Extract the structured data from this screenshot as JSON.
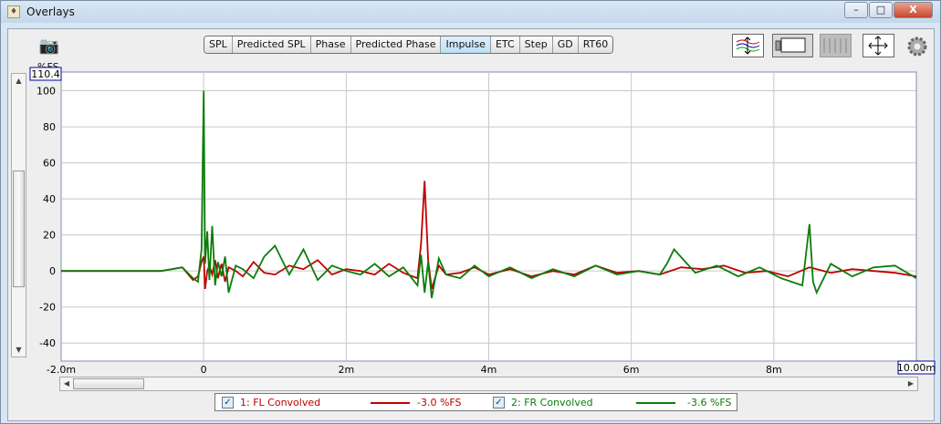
{
  "window": {
    "title": "Overlays",
    "controls": [
      "–",
      "□",
      "X"
    ]
  },
  "tabs": [
    "SPL",
    "Predicted SPL",
    "Phase",
    "Predicted Phase",
    "Impulse",
    "ETC",
    "Step",
    "GD",
    "RT60"
  ],
  "active_tab": "Impulse",
  "icons": {
    "camera": "camera-icon",
    "tools": [
      "trace-arrange-icon",
      "monitor-icon",
      "grid-panel-icon",
      "move-icon",
      "gear-icon"
    ]
  },
  "axis": {
    "y_unit": "%FS",
    "y_top_marker": "110.4",
    "x_right_marker": "10.00m"
  },
  "legend": [
    {
      "name": "1: FL Convolved",
      "value": "-3.0 %FS",
      "color": "#c00000"
    },
    {
      "name": "2: FR Convolved",
      "value": "-3.6 %FS",
      "color": "#0a7d0a"
    }
  ],
  "chart_data": {
    "type": "line",
    "x_ticks": [
      "-2.0m",
      "0",
      "2m",
      "4m",
      "6m",
      "8m"
    ],
    "y_ticks": [
      100,
      80,
      60,
      40,
      20,
      0,
      -20,
      -40
    ],
    "xlim": [
      -2.0,
      10.0
    ],
    "ylim": [
      -50,
      110.4
    ],
    "grid": true,
    "series": [
      {
        "name": "1: FL Convolved",
        "color": "#c00000",
        "x": [
          -2.0,
          -1.5,
          -1.0,
          -0.6,
          -0.3,
          -0.15,
          -0.08,
          -0.03,
          0.0,
          0.02,
          0.05,
          0.08,
          0.12,
          0.16,
          0.2,
          0.25,
          0.3,
          0.35,
          0.45,
          0.55,
          0.7,
          0.85,
          1.0,
          1.2,
          1.4,
          1.6,
          1.8,
          2.0,
          2.2,
          2.4,
          2.6,
          2.8,
          3.0,
          3.05,
          3.1,
          3.15,
          3.2,
          3.3,
          3.4,
          3.6,
          3.8,
          4.0,
          4.3,
          4.6,
          4.9,
          5.2,
          5.5,
          5.8,
          6.1,
          6.4,
          6.7,
          7.0,
          7.3,
          7.6,
          7.9,
          8.2,
          8.5,
          8.8,
          9.1,
          9.4,
          9.7,
          10.0
        ],
        "y": [
          0,
          0,
          0,
          0,
          2,
          -5,
          -3,
          5,
          8,
          -10,
          0,
          3,
          -2,
          6,
          -4,
          4,
          -6,
          2,
          0,
          -3,
          5,
          -1,
          -2,
          3,
          1,
          6,
          -2,
          1,
          0,
          -2,
          4,
          -1,
          -4,
          15,
          50,
          6,
          -10,
          3,
          -2,
          -1,
          2,
          -2,
          1,
          -3,
          0,
          -2,
          3,
          -1,
          0,
          -2,
          2,
          1,
          3,
          -1,
          0,
          -3,
          2,
          -1,
          1,
          0,
          -1,
          -3
        ]
      },
      {
        "name": "2: FR Convolved",
        "color": "#0a7d0a",
        "x": [
          -2.0,
          -1.5,
          -1.0,
          -0.6,
          -0.3,
          -0.15,
          -0.08,
          -0.03,
          0.0,
          0.02,
          0.05,
          0.08,
          0.12,
          0.16,
          0.2,
          0.25,
          0.3,
          0.35,
          0.45,
          0.55,
          0.7,
          0.85,
          1.0,
          1.2,
          1.4,
          1.6,
          1.8,
          2.0,
          2.2,
          2.4,
          2.6,
          2.8,
          3.0,
          3.05,
          3.1,
          3.15,
          3.2,
          3.3,
          3.4,
          3.6,
          3.8,
          4.0,
          4.3,
          4.6,
          4.9,
          5.2,
          5.5,
          5.8,
          6.1,
          6.4,
          6.5,
          6.6,
          6.9,
          7.2,
          7.5,
          7.8,
          8.1,
          8.4,
          8.5,
          8.55,
          8.6,
          8.8,
          9.1,
          9.4,
          9.7,
          10.0
        ],
        "y": [
          0,
          0,
          0,
          0,
          2,
          -4,
          -6,
          12,
          100,
          4,
          22,
          -5,
          25,
          -8,
          5,
          -3,
          8,
          -12,
          3,
          1,
          -4,
          8,
          14,
          -2,
          12,
          -5,
          3,
          0,
          -2,
          4,
          -3,
          2,
          -8,
          9,
          -12,
          5,
          -15,
          7,
          -2,
          -4,
          3,
          -3,
          2,
          -4,
          1,
          -3,
          3,
          -2,
          0,
          -2,
          4,
          12,
          -1,
          3,
          -3,
          2,
          -4,
          -8,
          26,
          -6,
          -12,
          4,
          -3,
          2,
          3,
          -4
        ]
      }
    ]
  }
}
